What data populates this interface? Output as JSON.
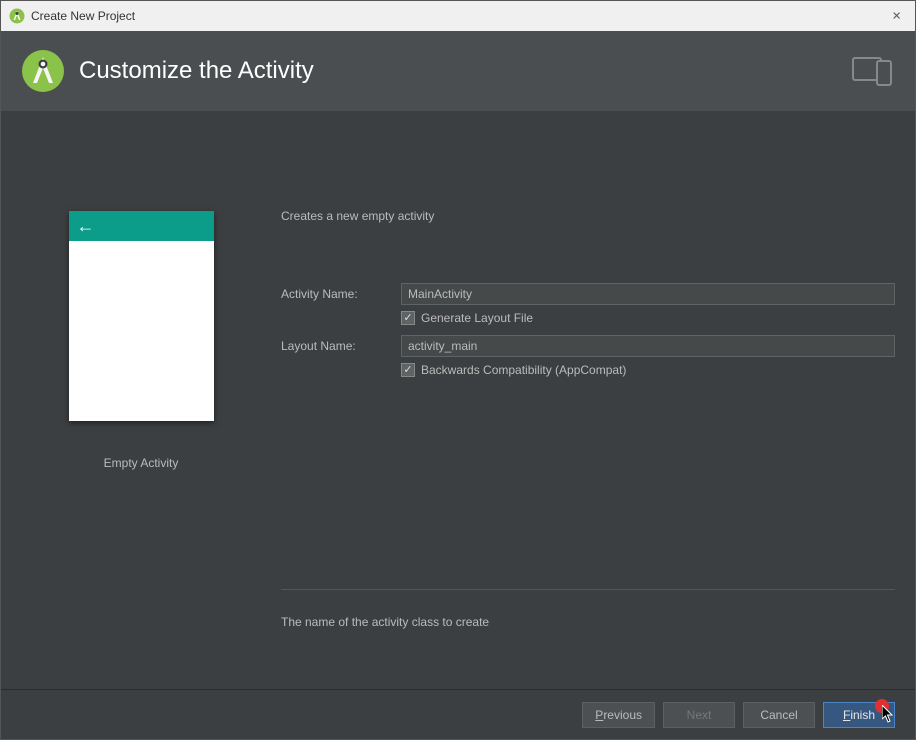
{
  "window": {
    "title": "Create New Project"
  },
  "header": {
    "title": "Customize the Activity"
  },
  "preview": {
    "caption": "Empty Activity"
  },
  "form": {
    "description": "Creates a new empty activity",
    "activity_name_label": "Activity Name:",
    "activity_name_value": "MainActivity",
    "generate_layout_label": "Generate Layout File",
    "generate_layout_checked": true,
    "layout_name_label": "Layout Name:",
    "layout_name_value": "activity_main",
    "backwards_compat_label": "Backwards Compatibility (AppCompat)",
    "backwards_compat_checked": true,
    "helper_text": "The name of the activity class to create"
  },
  "buttons": {
    "previous": "Previous",
    "next": "Next",
    "cancel": "Cancel",
    "finish": "Finish"
  }
}
